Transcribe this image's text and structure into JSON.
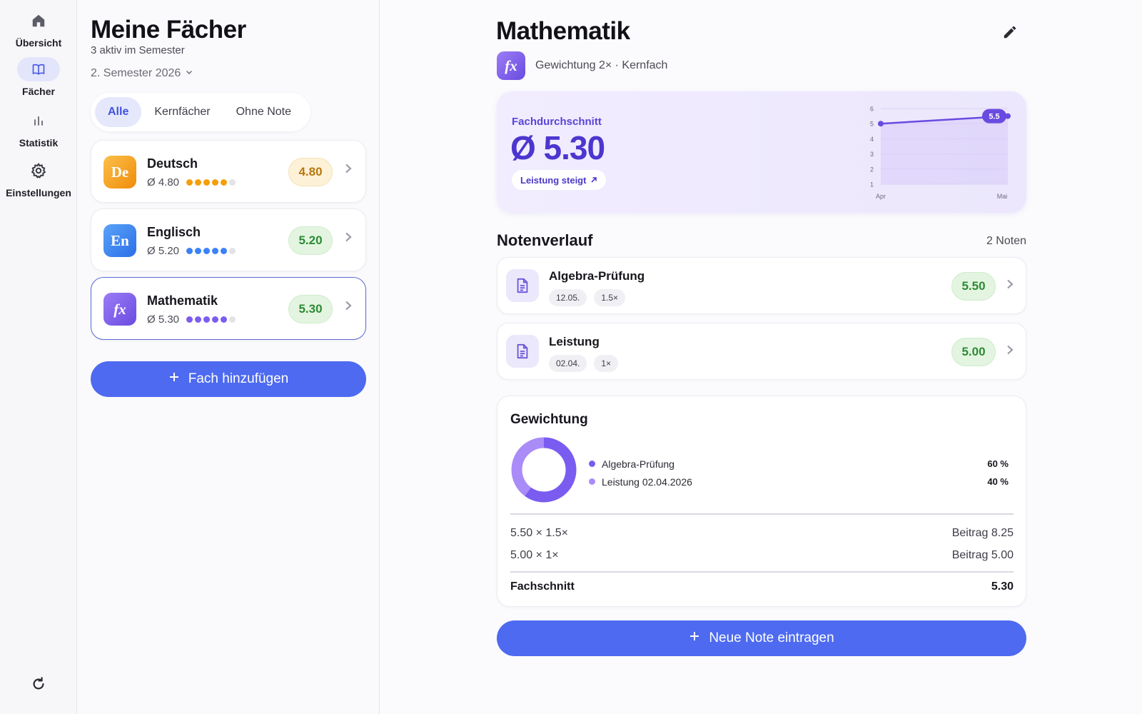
{
  "nav": {
    "items": [
      {
        "label": "Übersicht",
        "icon": "home-icon"
      },
      {
        "label": "Fächer",
        "icon": "book-icon"
      },
      {
        "label": "Statistik",
        "icon": "bar-chart-icon"
      },
      {
        "label": "Einstellungen",
        "icon": "gear-icon"
      }
    ],
    "active": "Fächer",
    "refresh_icon": "refresh-icon"
  },
  "list": {
    "title": "Meine Fächer",
    "subtitle": "3 aktiv im Semester",
    "semester": "2. Semester 2026",
    "filters": [
      "Alle",
      "Kernfächer",
      "Ohne Note"
    ],
    "active_filter": "Alle",
    "subjects": [
      {
        "abbr": "De",
        "name": "Deutsch",
        "avg": "Ø 4.80",
        "grade": "4.80",
        "rating": 4.8,
        "color": "#f59e0b",
        "badge": "amber"
      },
      {
        "abbr": "En",
        "name": "Englisch",
        "avg": "Ø 5.20",
        "grade": "5.20",
        "rating": 5.2,
        "color": "#3b82f6",
        "badge": "green"
      },
      {
        "abbr": "fx",
        "name": "Mathematik",
        "avg": "Ø 5.30",
        "grade": "5.30",
        "rating": 5.3,
        "color": "#7c5cf0",
        "badge": "green"
      }
    ],
    "selected": "Mathematik",
    "add_button": "Fach hinzufügen"
  },
  "detail": {
    "title": "Mathematik",
    "avatar": "fx",
    "meta": "Gewichtung 2× · Kernfach",
    "edit_icon": "pencil-icon",
    "average_label": "Fachdurchschnitt",
    "average_value": "Ø 5.30",
    "trend": "Leistung steigt",
    "history_title": "Notenverlauf",
    "history_count": "2 Noten",
    "grades": [
      {
        "name": "Algebra-Prüfung",
        "date": "12.05.",
        "weight": "1.5×",
        "grade": "5.50"
      },
      {
        "name": "Leistung",
        "date": "02.04.",
        "weight": "1×",
        "grade": "5.00"
      }
    ],
    "weighting": {
      "title": "Gewichtung",
      "items": [
        {
          "label": "Algebra-Prüfung",
          "pct_text": "60 %",
          "pct": 60,
          "color": "#7a5cf0"
        },
        {
          "label": "Leistung 02.04.2026",
          "pct_text": "40 %",
          "pct": 40,
          "color": "#a98cf7"
        }
      ],
      "calc": [
        {
          "expr": "5.50 × 1.5×",
          "contribution": "Beitrag 8.25"
        },
        {
          "expr": "5.00 × 1×",
          "contribution": "Beitrag 5.00"
        }
      ],
      "total_label": "Fachschnitt",
      "total_value": "5.30"
    },
    "add_button": "Neue Note eintragen"
  },
  "chart_data": {
    "type": "line",
    "x": [
      "Apr",
      "Mai"
    ],
    "categories": [
      "Apr",
      "Mai"
    ],
    "series": [
      {
        "values": [
          5.0,
          5.5
        ]
      }
    ],
    "yticks": [
      1,
      2,
      3,
      4,
      5,
      6
    ],
    "ylim": [
      1,
      6
    ],
    "last_label": "5.5",
    "grid": true,
    "color": "#6a4be0"
  }
}
